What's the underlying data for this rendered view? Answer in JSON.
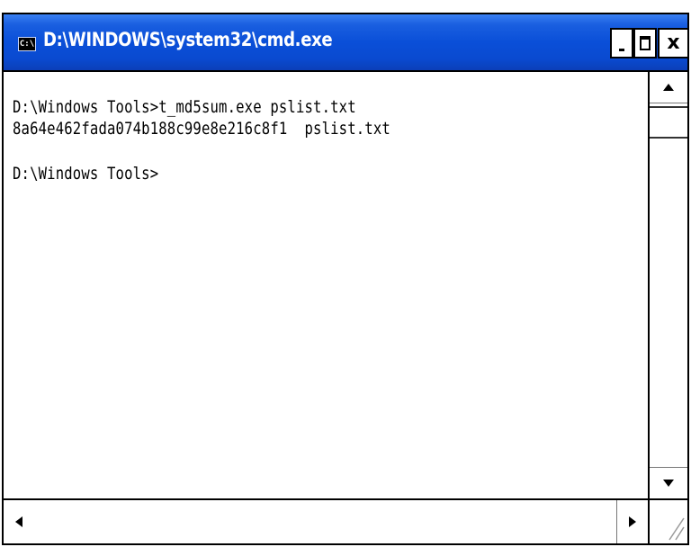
{
  "window": {
    "title": "D:\\WINDOWS\\system32\\cmd.exe",
    "icon_label": "C:\\",
    "buttons": {
      "minimize": "minimize-icon",
      "maximize": "maximize-icon",
      "close": "close-icon"
    }
  },
  "console": {
    "lines": [
      "D:\\Windows Tools>t_md5sum.exe pslist.txt",
      "8a64e462fada074b188c99e8e216c8f1  pslist.txt",
      "",
      "D:\\Windows Tools>"
    ]
  },
  "colors": {
    "titlebar": "#0a4fd8",
    "title_text": "#ffffff",
    "console_bg": "#ffffff",
    "console_text": "#000000"
  }
}
